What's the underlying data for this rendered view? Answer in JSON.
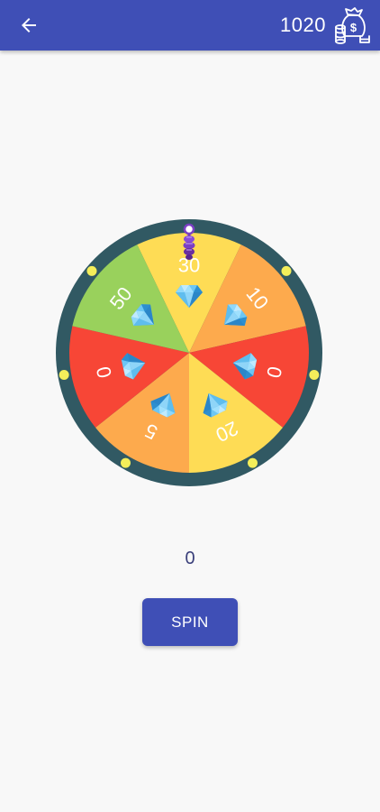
{
  "header": {
    "back_icon": "arrow-left-icon",
    "balance": "1020",
    "wallet_icon": "money-bag-icon",
    "background": "#3f4fb6"
  },
  "wheel": {
    "rim_color": "#315963",
    "segments": [
      {
        "label": "30",
        "color": "#fedc55"
      },
      {
        "label": "10",
        "color": "#fdaa4d"
      },
      {
        "label": "0",
        "color": "#f74636"
      },
      {
        "label": "20",
        "color": "#fedc55"
      },
      {
        "label": "5",
        "color": "#fdaa4d"
      },
      {
        "label": "0",
        "color": "#f74636"
      },
      {
        "label": "50",
        "color": "#99d15c"
      }
    ],
    "prize_icon": "diamond-icon",
    "pointer_icon": "pointer-pin-icon"
  },
  "result": "0",
  "spin_button": {
    "label": "SPIN"
  }
}
